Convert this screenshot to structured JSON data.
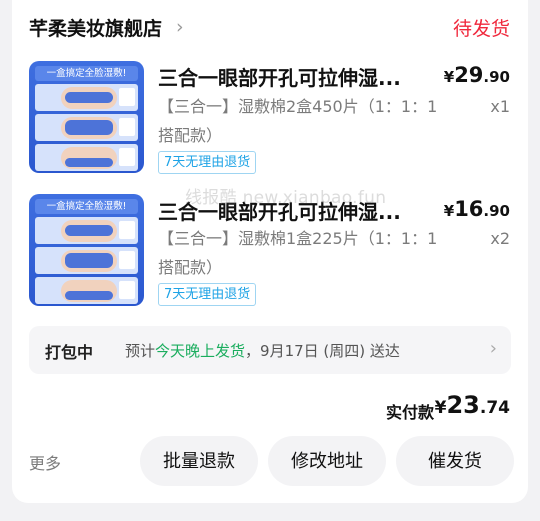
{
  "shop": {
    "name": "芊柔美妆旗舰店",
    "chevron_icon": "chevron-right-icon",
    "status": "待发货"
  },
  "items": [
    {
      "title": "三合一眼部开孔可拉伸湿...",
      "price_currency": "¥",
      "price_int": "29",
      "price_dec": ".90",
      "spec_line1": "【三合一】湿敷棉2盒450片（1：1：1",
      "spec_line2": "搭配款）",
      "qty": "x1",
      "tag": "7天无理由退货",
      "thumb_banner": "一盒搞定全脸湿敷!"
    },
    {
      "title": "三合一眼部开孔可拉伸湿...",
      "price_currency": "¥",
      "price_int": "16",
      "price_dec": ".90",
      "spec_line1": "【三合一】湿敷棉1盒225片（1：1：1",
      "spec_line2": "搭配款）",
      "qty": "x2",
      "tag": "7天无理由退货",
      "thumb_banner": "一盒搞定全脸湿敷!"
    }
  ],
  "watermark": "线报酷 new.xianbao.fun",
  "shipping": {
    "label": "打包中",
    "prefix": "预计",
    "highlight": "今天晚上发货",
    "suffix": "，9月17日 (周四) 送达",
    "chevron_icon": "chevron-right-icon",
    "highlight_color": "#1aad5e"
  },
  "payment": {
    "label": "实付款",
    "currency": "¥",
    "int": "23",
    "dec": ".74"
  },
  "actions": {
    "more": "更多",
    "refund": "批量退款",
    "address": "修改地址",
    "urge": "催发货"
  },
  "colors": {
    "status": "#f0283c",
    "tag": "#1ea3e6",
    "thumb_bg": "#3f6fe0"
  }
}
